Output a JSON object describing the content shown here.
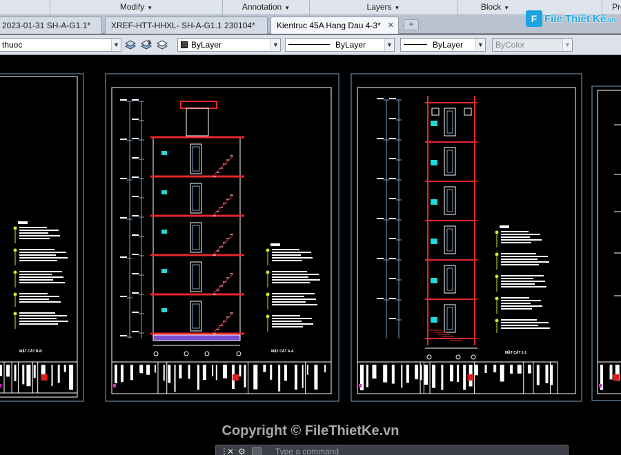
{
  "ribbon": {
    "panels": [
      {
        "label": "Modify"
      },
      {
        "label": "Annotation"
      },
      {
        "label": "Layers"
      },
      {
        "label": "Block"
      },
      {
        "label": "Pro"
      }
    ]
  },
  "tabs": [
    {
      "label": "2023-01-31 SH-A-G1.1*",
      "active": false
    },
    {
      "label": "XREF-HTT-HHXL- SH-A-G1.1 230104*",
      "active": false
    },
    {
      "label": "Kientruc 45A Hang Dau 4-3*",
      "active": true
    }
  ],
  "watermark_logo": {
    "text": "File Thiết Kế",
    "suffix": ".vn"
  },
  "toolbar": {
    "layer_combo": "thuoc",
    "color_combo": "ByLayer",
    "linetype_combo": "ByLayer",
    "lineweight_combo": "ByLayer",
    "plotstyle_combo": "ByColor"
  },
  "sheets": [
    {
      "title": "MẶT CẮT B-B"
    },
    {
      "title": "MẶT CẮT A-A"
    },
    {
      "title": "MẶT CẮT 1-1"
    }
  ],
  "copyright": "Copyright © FileThietKe.vn",
  "cmdline": {
    "placeholder": "Type a command"
  },
  "colors": {
    "canvas": "#000000",
    "wall": "#e8262d",
    "line": "#ffffff",
    "dim": "#7fa3c8",
    "tag": "#24d6d6",
    "marker": "#d6e82a"
  }
}
